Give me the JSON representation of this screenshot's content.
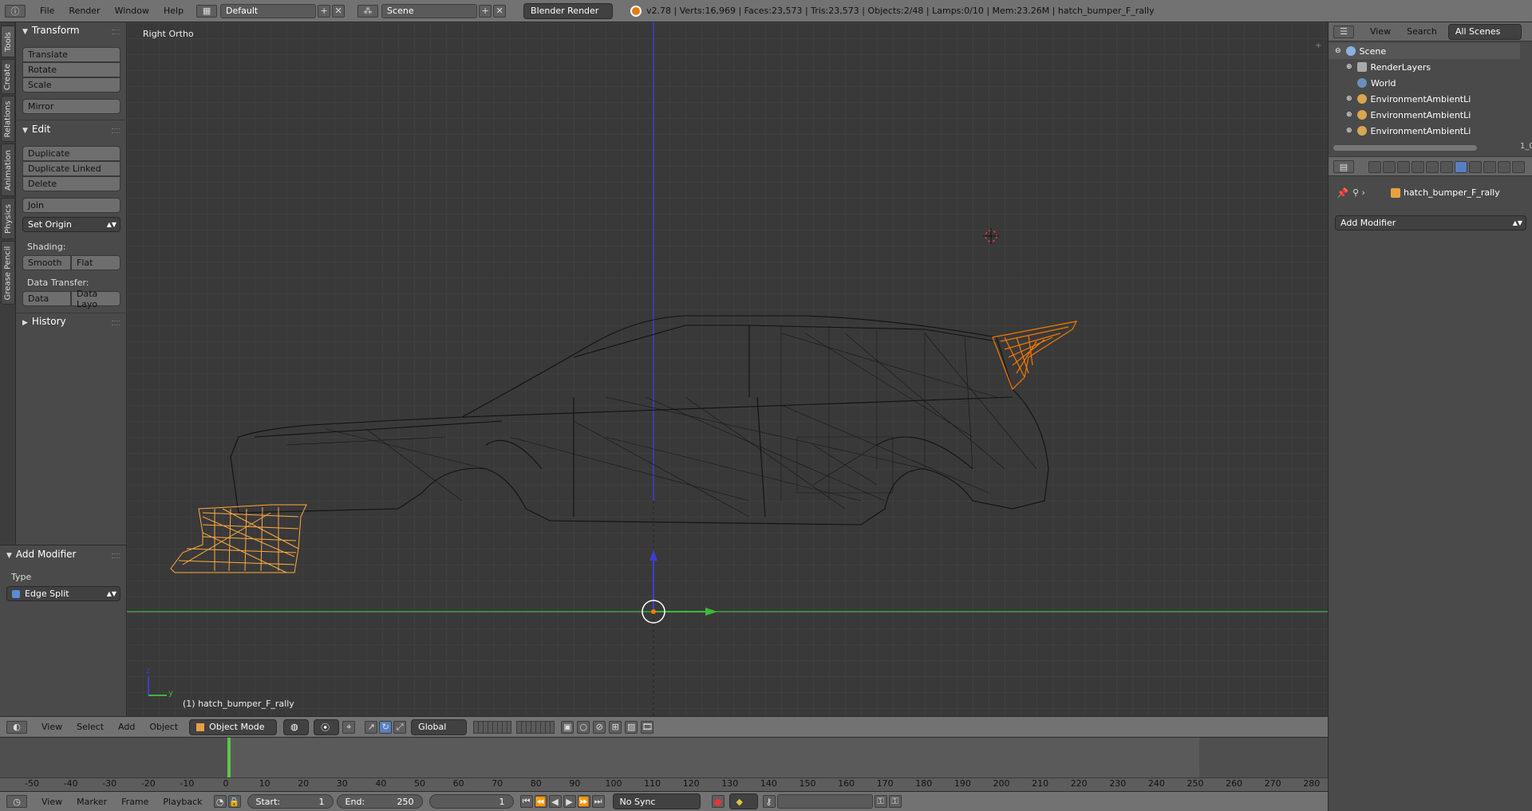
{
  "topbar": {
    "menu": [
      "File",
      "Render",
      "Window",
      "Help"
    ],
    "layout": "Default",
    "scene": "Scene",
    "engine": "Blender Render",
    "stats": "v2.78 | Verts:16,969 | Faces:23,573 | Tris:23,573 | Objects:2/48 | Lamps:0/10 | Mem:23.26M | hatch_bumper_F_rally"
  },
  "tabs": [
    "Tools",
    "Create",
    "Relations",
    "Animation",
    "Physics",
    "Grease Pencil"
  ],
  "toolshelf": {
    "transform_title": "Transform",
    "translate": "Translate",
    "rotate": "Rotate",
    "scale": "Scale",
    "mirror": "Mirror",
    "edit_title": "Edit",
    "duplicate": "Duplicate",
    "duplicate_linked": "Duplicate Linked",
    "delete": "Delete",
    "join": "Join",
    "set_origin": "Set Origin",
    "shading_label": "Shading:",
    "smooth": "Smooth",
    "flat": "Flat",
    "data_transfer_label": "Data Transfer:",
    "data": "Data",
    "data_layout": "Data Layo",
    "history_title": "History"
  },
  "operator": {
    "title": "Add Modifier",
    "type_label": "Type",
    "type_value": "Edge Split"
  },
  "viewport": {
    "view_label": "Right Ortho",
    "object_label": "(1) hatch_bumper_F_rally",
    "axis_z": "z",
    "axis_y": "y"
  },
  "outliner": {
    "view": "View",
    "search": "Search",
    "filter": "All Scenes",
    "items": [
      "Scene",
      "RenderLayers",
      "World",
      "EnvironmentAmbientLi",
      "EnvironmentAmbientLi",
      "EnvironmentAmbientLi"
    ],
    "side_text": "1_0"
  },
  "properties": {
    "object_name": "hatch_bumper_F_rally",
    "add_modifier": "Add Modifier"
  },
  "viewheader": {
    "menu": [
      "View",
      "Select",
      "Add",
      "Object"
    ],
    "mode": "Object Mode",
    "orientation": "Global"
  },
  "timeline": {
    "ticks": [
      "-50",
      "-40",
      "-30",
      "-20",
      "-10",
      "0",
      "10",
      "20",
      "30",
      "40",
      "50",
      "60",
      "70",
      "80",
      "90",
      "100",
      "110",
      "120",
      "130",
      "140",
      "150",
      "160",
      "170",
      "180",
      "190",
      "200",
      "210",
      "220",
      "230",
      "240",
      "250",
      "260",
      "270",
      "280"
    ],
    "menu": [
      "View",
      "Marker",
      "Frame",
      "Playback"
    ],
    "start_label": "Start:",
    "start_value": "1",
    "end_label": "End:",
    "end_value": "250",
    "current_frame": "1",
    "sync": "No Sync"
  },
  "colors": {
    "selected_orange": "#f57900",
    "active_orange": "#ffaa40",
    "x_axis": "#3db83d",
    "z_axis": "#3d3dd6"
  }
}
